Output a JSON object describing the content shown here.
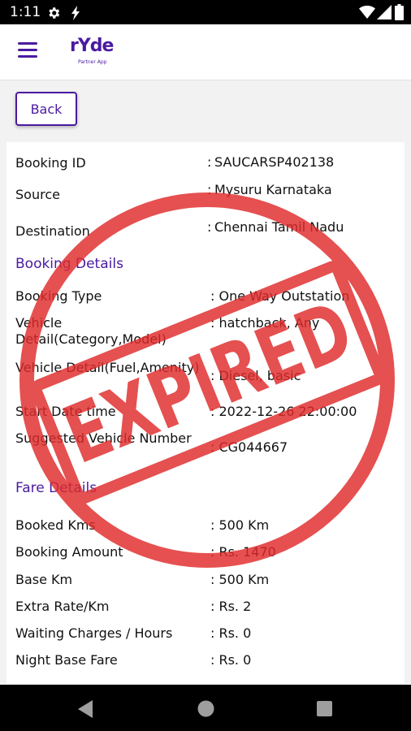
{
  "status_bar": {
    "time": "1:11",
    "icons": [
      "settings-icon",
      "bolt-icon",
      "wifi-icon",
      "signal-icon",
      "battery-icon"
    ]
  },
  "app_bar": {
    "logo_text": "rYde",
    "logo_tagline": "Partner App",
    "menu_icon": "hamburger-menu-icon"
  },
  "back_button": {
    "label": "Back"
  },
  "details": [
    {
      "label": "Booking ID",
      "sep": ":",
      "value": "SAUCARSP402138"
    },
    {
      "label": "Source",
      "sep": ":",
      "value": "Mysuru Karnataka"
    },
    {
      "label": "Destination",
      "sep": ":",
      "value": "Chennai Tamil Nadu"
    }
  ],
  "booking_section": {
    "title": "Booking Details",
    "rows": [
      {
        "label": "Booking Type",
        "value": ": One Way Outstation"
      },
      {
        "label": "Vehicle Detail(Category,Model)",
        "value": ": hatchback, Any"
      },
      {
        "label": "Vehicle Detail(Fuel,Amenity)",
        "value": ": Diesel, basic"
      },
      {
        "label": "Start Date time",
        "value": ": 2022-12-26 22:00:00"
      },
      {
        "label": "Suggested Vehicle Number",
        "value": ": CG044667"
      }
    ]
  },
  "fare_section": {
    "title": "Fare Details",
    "rows": [
      {
        "label": "Booked Kms",
        "value": ": 500 Km"
      },
      {
        "label": "Booking Amount",
        "value": ": Rs.  1470"
      },
      {
        "label": "Base Km",
        "value": ": 500 Km"
      },
      {
        "label": "Extra Rate/Km",
        "value": ": Rs.  2"
      },
      {
        "label": "Waiting Charges / Hours",
        "value": ": Rs. 0"
      },
      {
        "label": "Night Base Fare",
        "value": ": Rs. 0"
      }
    ]
  },
  "stamp": {
    "text": "EXPIRED",
    "color": "#e02a2a"
  },
  "colors": {
    "accent": "#4a1aa0"
  },
  "nav_bar": {
    "icons": [
      "back-triangle-icon",
      "home-circle-icon",
      "recents-square-icon"
    ]
  }
}
